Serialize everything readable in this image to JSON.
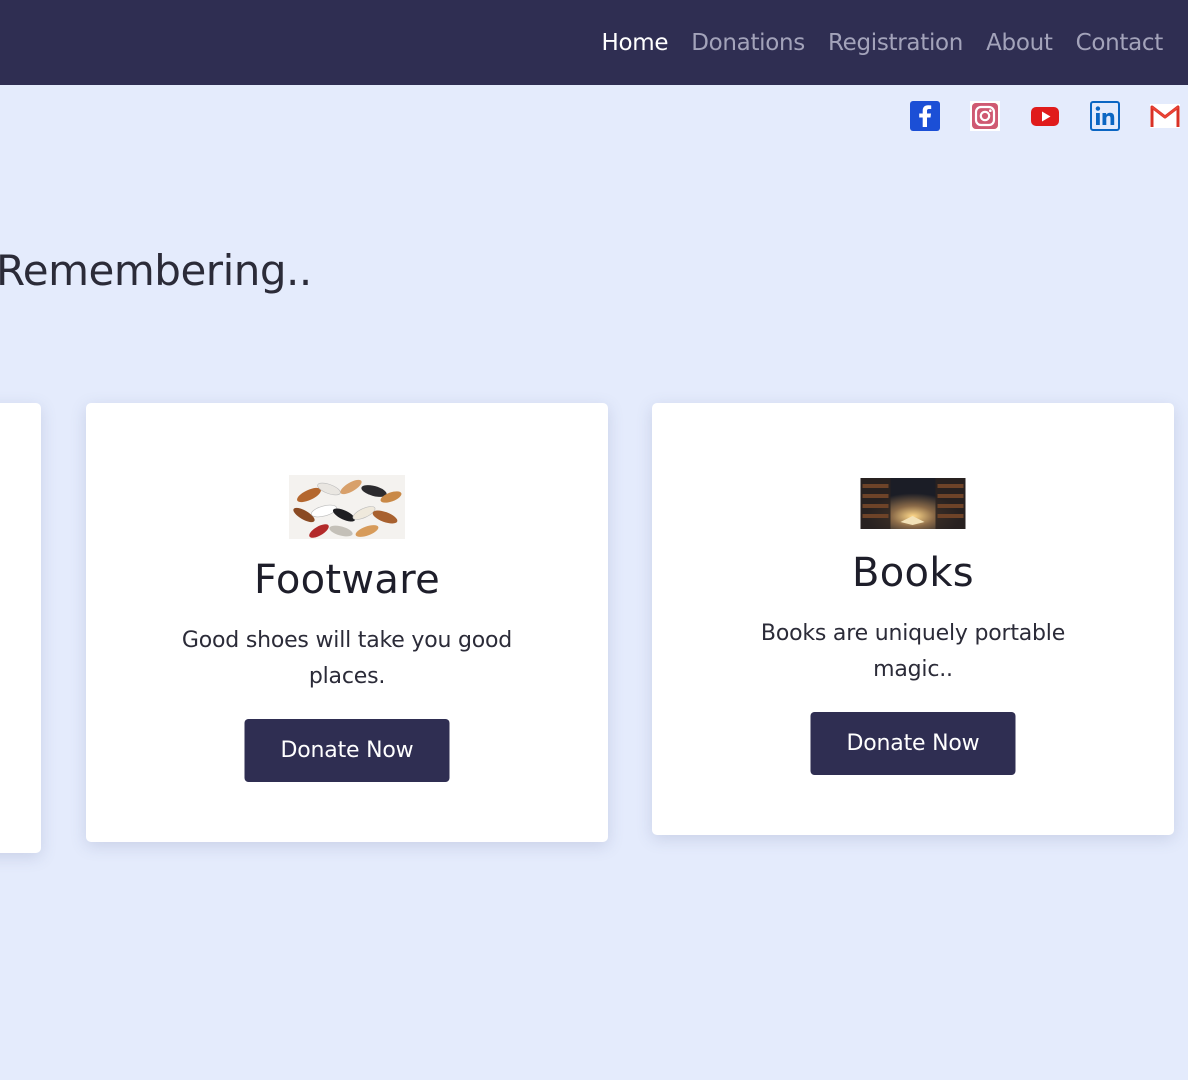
{
  "nav": {
    "items": [
      {
        "label": "Home",
        "active": true
      },
      {
        "label": "Donations",
        "active": false
      },
      {
        "label": "Registration",
        "active": false
      },
      {
        "label": "About",
        "active": false
      },
      {
        "label": "Contact",
        "active": false
      }
    ]
  },
  "social": {
    "icons": [
      "facebook-icon",
      "instagram-icon",
      "youtube-icon",
      "linkedin-icon",
      "gmail-icon"
    ]
  },
  "main": {
    "heading": "Remembering.."
  },
  "cards": [
    {
      "image": "shoes-image",
      "title": "Footware",
      "text": "Good shoes will take you good places.",
      "button": "Donate Now"
    },
    {
      "image": "books-image",
      "title": "Books",
      "text": "Books are uniquely portable magic..",
      "button": "Donate Now"
    }
  ],
  "colors": {
    "navbar": "#2f2e52",
    "background": "#e4ebfc",
    "button": "#2f2e52",
    "card": "#ffffff"
  }
}
